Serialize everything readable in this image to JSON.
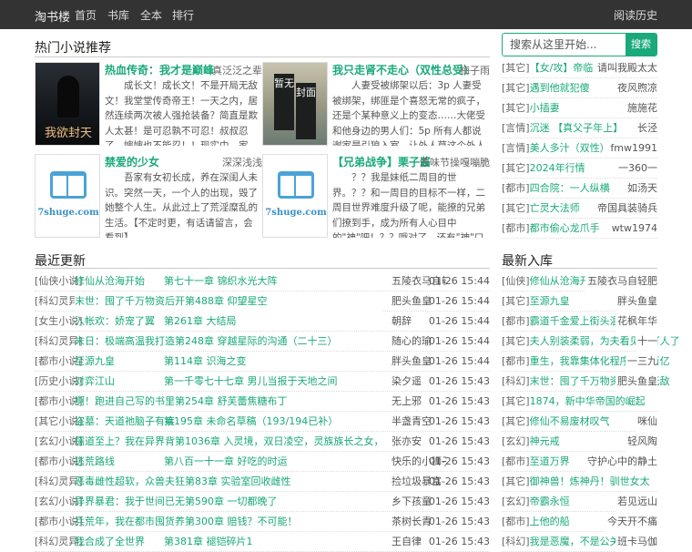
{
  "nav": {
    "brand": "淘书楼",
    "items": [
      "首页",
      "书库",
      "全本",
      "排行"
    ],
    "history": "阅读历史"
  },
  "search": {
    "placeholder": "搜索从这里开始...",
    "button": "搜索"
  },
  "hot": {
    "title": "热门小说推荐",
    "books": [
      {
        "title": "热血传奇：我才是巅峰",
        "author": "真泛泛之辈",
        "desc": "成长文！成长文！不是开局无敌文！我堂堂传奇帝王！一天之内，居然连续两次被人强抢装备？简直是欺人太甚！是可忍孰不可忍！叔叔忍了，婶婶也不能忍！！现实中，家人、兄弟，被人当做要挟他的筹码……曾经的恋",
        "cover_caption": "我欲封天"
      },
      {
        "title": "我只走肾不走心（双性总受）",
        "author": "梅子雨",
        "desc": "人妻受被绑架以后：3p 人妻受被绑架，绑匪是个喜怒无常的疯子，还是个某种意义上的变态……大佬受和他身边的男人们：5p 所有人都说谢家是引狼入室，让外人莫这个外人掌控了谢家的权势，把偌大的家业都给了",
        "cover_caption": "暂无封面"
      },
      {
        "title": "禁爱的少女",
        "author": "深深浅浅",
        "desc": "吾家有女初长成，养在深闺人未识。突然一天，一个人的出现，毁了她整个人生。从此过上了荒淫糜乱的生活。【不定时更，有话请留言，会看到】",
        "cover_caption": "7shuge.com"
      },
      {
        "title": "【兄弟战争】栗子酱",
        "author": "原味节操嘎嘣脆",
        "desc": "？？我是妹纸二周目的世界。？？和一周目的目标不一样，二周目世界难度升级了呢，能撩的兄弟们撩到手，成为所有人心目中的\"神\"吧！？？哦对了，还有\"神\"口中本来的自己，义无反顾的选择了更加艰难的模式。？？最主要是无辜可人的女孩",
        "cover_caption": "7shuge.com"
      }
    ]
  },
  "side_hot": [
    {
      "cat": "[其它]",
      "name": "【女/攻】帝临",
      "author": "请叫我殿太太"
    },
    {
      "cat": "[其它]",
      "name": "遇到他就犯傻",
      "author": "夜风煦凉"
    },
    {
      "cat": "[其它]",
      "name": "小插妻",
      "author": "施施花"
    },
    {
      "cat": "[言情]",
      "name": "沉迷 【真父子年上】",
      "author": "长泾"
    },
    {
      "cat": "[言情]",
      "name": "美人多汁（双性）",
      "author": "fmw1991"
    },
    {
      "cat": "[其它]",
      "name": "2024年行情",
      "author": "一360一"
    },
    {
      "cat": "[都市]",
      "name": "四合院：一人纵横",
      "author": "如汤天"
    },
    {
      "cat": "[其它]",
      "name": "亡灵大法师",
      "author": "帝国具装骑兵"
    },
    {
      "cat": "[都市]",
      "name": "都市偷心龙爪手",
      "author": "wtw1974"
    }
  ],
  "recent": {
    "title": "最近更新",
    "rows": [
      {
        "cat": "[仙侠小说]",
        "name": "修仙从沧海开始",
        "chapter": "第七十一章 锦织水光大阵",
        "author": "五陵衣马自轻肥",
        "time": "01-26 15:44"
      },
      {
        "cat": "[科幻灵异]",
        "name": "末世：囤了千万物资后开第488章 仰望星空",
        "chapter": "第488章 仰望星空",
        "author": "肥头鱼皇",
        "time": "01-26 15:44"
      },
      {
        "cat": "[女生小说]",
        "name": "入帐欢：娇宠了翼",
        "chapter": "第261章 大结局",
        "author": "朝辞",
        "time": "01-26 15:44"
      },
      {
        "cat": "[科幻灵异]",
        "name": "末日：极端高温我打造第248章 穿越星际的沟通（二十三）",
        "chapter": "第248章 穿越星际的沟通（二十三）",
        "author": "随心的瑜",
        "time": "01-26 15:44"
      },
      {
        "cat": "[都市小说]",
        "name": "至源九皇",
        "chapter": "第114章 识海之变",
        "author": "胖头鱼皇",
        "time": "01-26 15:44"
      },
      {
        "cat": "[历史小说]",
        "name": "对弈江山",
        "chapter": "第一千零七十七章 男儿当报于天地之间",
        "author": "染夕遥",
        "time": "01-26 15:43"
      },
      {
        "cat": "[都市小说]",
        "name": "啊！跑进自己写的书里第254章 舒芙蕾焦糖布丁",
        "chapter": "第254章 舒芙蕾焦糖布丁",
        "author": "无上邪",
        "time": "01-26 15:43"
      },
      {
        "cat": "[其它小说]",
        "name": "盗墓：天道祂脑子有疾",
        "chapter": "第195章 未命名草稿（193/194已补）",
        "author": "半盏青空",
        "time": "01-26 15:43"
      },
      {
        "cat": "[玄幻小说]",
        "name": "儒道至上？我在异界背第1036章 入灵境，双日凌空，灵族族长之女，灵柔",
        "chapter": "第1036章 入灵境，双日凌空，灵族族长之女，灵柔",
        "author": "张亦安",
        "time": "01-26 15:43"
      },
      {
        "cat": "[都市小说]",
        "name": "逃荒路线",
        "chapter": "第八百一十一章 好吃的时运",
        "author": "快乐的小狮子",
        "time": "01-26 15:43"
      },
      {
        "cat": "[科幻灵异]",
        "name": "恶毒雌性超软，众兽夫狂第83章 实验室回收雌性",
        "chapter": "第83章 实验室回收雌性",
        "author": "捡垃圾暴富",
        "time": "01-26 15:43"
      },
      {
        "cat": "[玄幻小说]",
        "name": "异界暴君：我于世间已无第590章 一切都晚了",
        "chapter": "第590章 一切都晚了",
        "author": "乡下孩童",
        "time": "01-26 15:43"
      },
      {
        "cat": "[都市小说]",
        "name": "兵荒年，我在都市囤货养第300章 赔钱？不可能！",
        "chapter": "第300章 赔钱？不可能！",
        "author": "茶树长青",
        "time": "01-26 15:43"
      },
      {
        "cat": "[科幻灵异]",
        "name": "我合成了全世界",
        "chapter": "第381章 褪铠碎片1",
        "author": "王自律",
        "time": "01-26 15:43"
      }
    ]
  },
  "new_books": {
    "title": "最新入库",
    "rows": [
      {
        "cat": "[仙侠]",
        "name": "修仙从沧海开始",
        "author": "五陵衣马自轻肥"
      },
      {
        "cat": "[其它]",
        "name": "至源九皇",
        "author": "胖头鱼皇"
      },
      {
        "cat": "[都市]",
        "name": "霸道千金爱上街头混混",
        "author": "花枫年华"
      },
      {
        "cat": "[其它]",
        "name": "夫人别装柔弱，为夫看见你打人了",
        "author": "十一"
      },
      {
        "cat": "[都市]",
        "name": "重生，我靠集体化程序赚了百亿",
        "author": "一三九"
      },
      {
        "cat": "[科幻]",
        "name": "末世：囤了千万物资后开始无敌",
        "author": "肥头鱼皇"
      },
      {
        "cat": "[其它]",
        "name": "1874，新中华帝国的崛起",
        "author": ""
      },
      {
        "cat": "[其它]",
        "name": "修仙不易废材叹气",
        "author": "咪仙"
      },
      {
        "cat": "[玄幻]",
        "name": "神元戒",
        "author": "轻风陶"
      },
      {
        "cat": "[都市]",
        "name": "至道万界",
        "author": "守护心中的静土"
      },
      {
        "cat": "[其它]",
        "name": "御神兽！炼神丹！驯世女太",
        "author": ""
      },
      {
        "cat": "[玄幻]",
        "name": "帝霸永恒",
        "author": "若见远山"
      },
      {
        "cat": "[都市]",
        "name": "上他的船",
        "author": "今天开不痛"
      },
      {
        "cat": "[科幻]",
        "name": "我是恶魔，不是公关",
        "author": "班卡马伽"
      }
    ]
  }
}
